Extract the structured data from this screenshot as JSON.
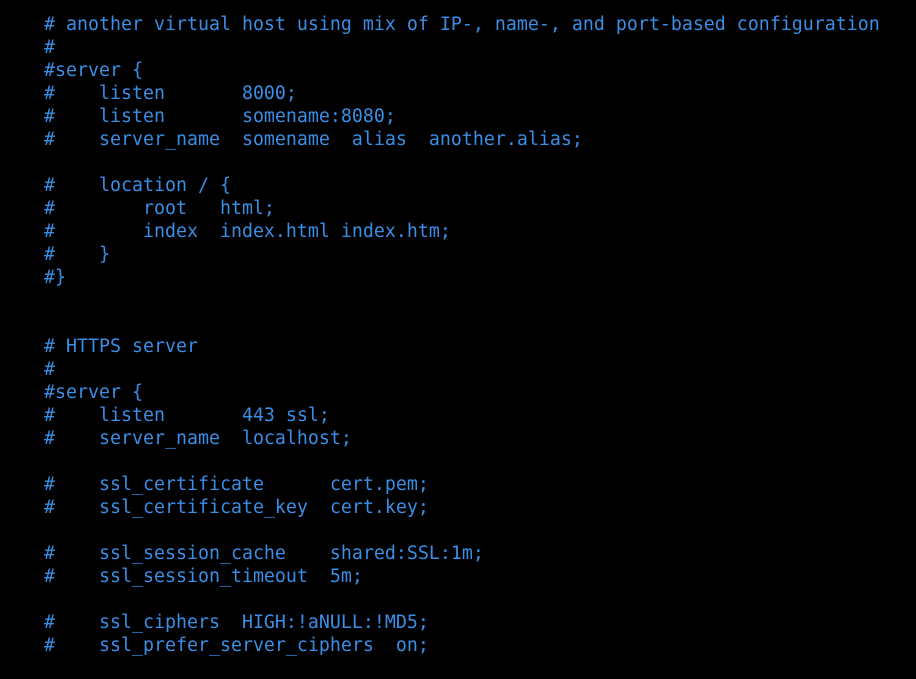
{
  "terminal": {
    "text_color": "#3a8ee6",
    "background": "#000000",
    "lines": [
      "# another virtual host using mix of IP-, name-, and port-based configuration",
      "#",
      "#server {",
      "#    listen       8000;",
      "#    listen       somename:8080;",
      "#    server_name  somename  alias  another.alias;",
      "",
      "#    location / {",
      "#        root   html;",
      "#        index  index.html index.htm;",
      "#    }",
      "#}",
      "",
      "",
      "# HTTPS server",
      "#",
      "#server {",
      "#    listen       443 ssl;",
      "#    server_name  localhost;",
      "",
      "#    ssl_certificate      cert.pem;",
      "#    ssl_certificate_key  cert.key;",
      "",
      "#    ssl_session_cache    shared:SSL:1m;",
      "#    ssl_session_timeout  5m;",
      "",
      "#    ssl_ciphers  HIGH:!aNULL:!MD5;",
      "#    ssl_prefer_server_ciphers  on;"
    ]
  }
}
